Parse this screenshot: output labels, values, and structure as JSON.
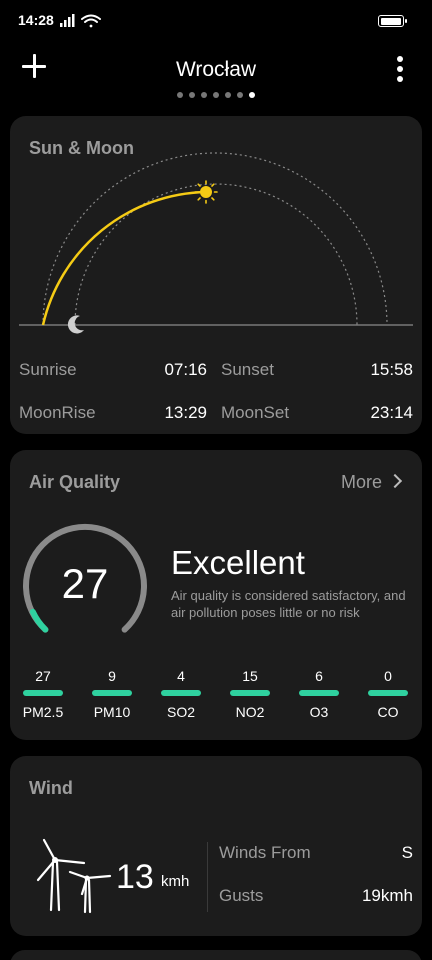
{
  "status_bar": {
    "time": "14:28",
    "icons": [
      "signal-icon",
      "wifi-icon",
      "battery-icon"
    ]
  },
  "header": {
    "city": "Wrocław",
    "page_count": 7,
    "active_page": 7
  },
  "sun_moon": {
    "title": "Sun & Moon",
    "sunrise_label": "Sunrise",
    "sunrise": "07:16",
    "sunset_label": "Sunset",
    "sunset": "15:58",
    "moonrise_label": "MoonRise",
    "moonrise": "13:29",
    "moonset_label": "MoonSet",
    "moonset": "23:14",
    "sun_color": "#f5cb15"
  },
  "air_quality": {
    "title": "Air Quality",
    "more_label": "More",
    "value": "27",
    "status": "Excellent",
    "description": "Air quality is considered satisfactory, and air pollution poses little or no risk",
    "accent_color": "#2fd19f",
    "pollutants": [
      {
        "value": "27",
        "name": "PM2.5"
      },
      {
        "value": "9",
        "name": "PM10"
      },
      {
        "value": "4",
        "name": "SO2"
      },
      {
        "value": "15",
        "name": "NO2"
      },
      {
        "value": "6",
        "name": "O3"
      },
      {
        "value": "0",
        "name": "CO"
      }
    ]
  },
  "wind": {
    "title": "Wind",
    "speed": "13",
    "unit": "kmh",
    "from_label": "Winds From",
    "from": "S",
    "gusts_label": "Gusts",
    "gusts": "19kmh"
  }
}
